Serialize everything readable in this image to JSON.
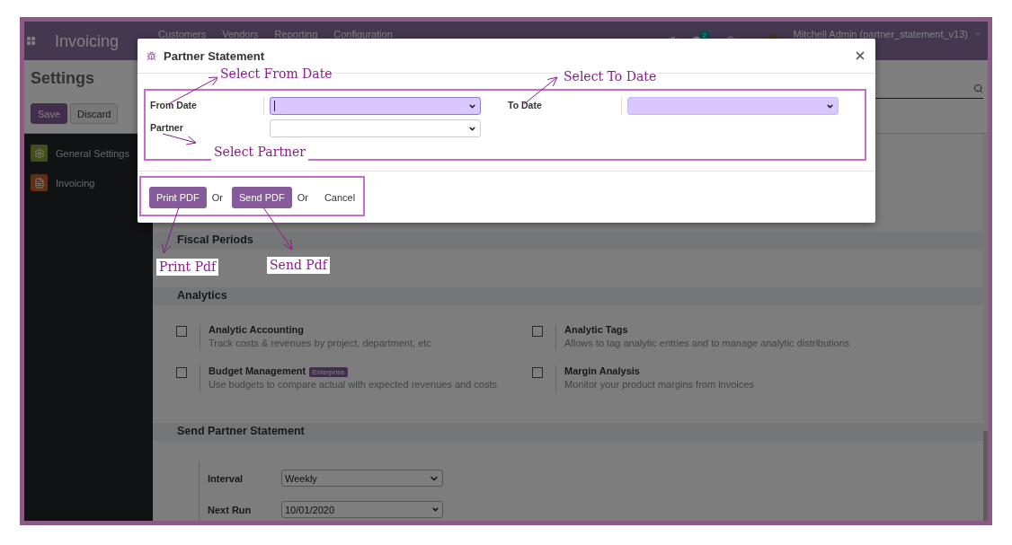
{
  "navbar": {
    "app_name": "Invoicing",
    "menu": [
      "Customers",
      "Vendors",
      "Reporting",
      "Configuration"
    ],
    "message_count": "2",
    "user": "Mitchell Admin (partner_statement_v13)"
  },
  "control_panel": {
    "title": "Settings",
    "buttons": [
      {
        "label": "Save",
        "kind": "primary"
      },
      {
        "label": "Discard",
        "kind": "secondary"
      }
    ]
  },
  "sidebar": {
    "items": [
      {
        "label": "General Settings",
        "kind": "general"
      },
      {
        "label": "Invoicing",
        "kind": "invoicing"
      }
    ]
  },
  "sections": [
    {
      "title": "Fiscal Periods"
    },
    {
      "title": "Analytics",
      "settings": [
        {
          "title": "Analytic Accounting",
          "description": "Track costs & revenues by project, department, etc",
          "checked": false
        },
        {
          "title": "Analytic Tags",
          "description": "Allows to tag analytic entries and to manage analytic distributions",
          "checked": false
        },
        {
          "title": "Budget Management",
          "badge": "Enterprise",
          "description": "Use budgets to compare actual with expected revenues and costs",
          "checked": false
        },
        {
          "title": "Margin Analysis",
          "description": "Monitor your product margins from invoices",
          "checked": false
        }
      ]
    },
    {
      "title": "Send Partner Statement",
      "fields": [
        {
          "label": "Interval",
          "value": "Weekly",
          "kind": "select"
        },
        {
          "label": "Next Run",
          "value": "10/01/2020",
          "kind": "date"
        }
      ]
    }
  ],
  "dialog": {
    "title": "Partner Statement",
    "fields": [
      {
        "label": "From Date",
        "kind": "date",
        "required": true,
        "focused": true
      },
      {
        "label": "To Date",
        "kind": "date",
        "required": true,
        "focused": false
      },
      {
        "label": "Partner",
        "kind": "select",
        "required": false,
        "focused": false
      }
    ],
    "footer": [
      {
        "label": "Print PDF",
        "kind": "primary"
      },
      {
        "label": "Or",
        "kind": "text"
      },
      {
        "label": "Send PDF",
        "kind": "primary"
      },
      {
        "label": "Or",
        "kind": "text"
      },
      {
        "label": "Cancel",
        "kind": "link"
      }
    ]
  },
  "annotations": [
    "Select From Date",
    "Select To Date",
    "Select Partner",
    "Print Pdf",
    "Send Pdf"
  ]
}
